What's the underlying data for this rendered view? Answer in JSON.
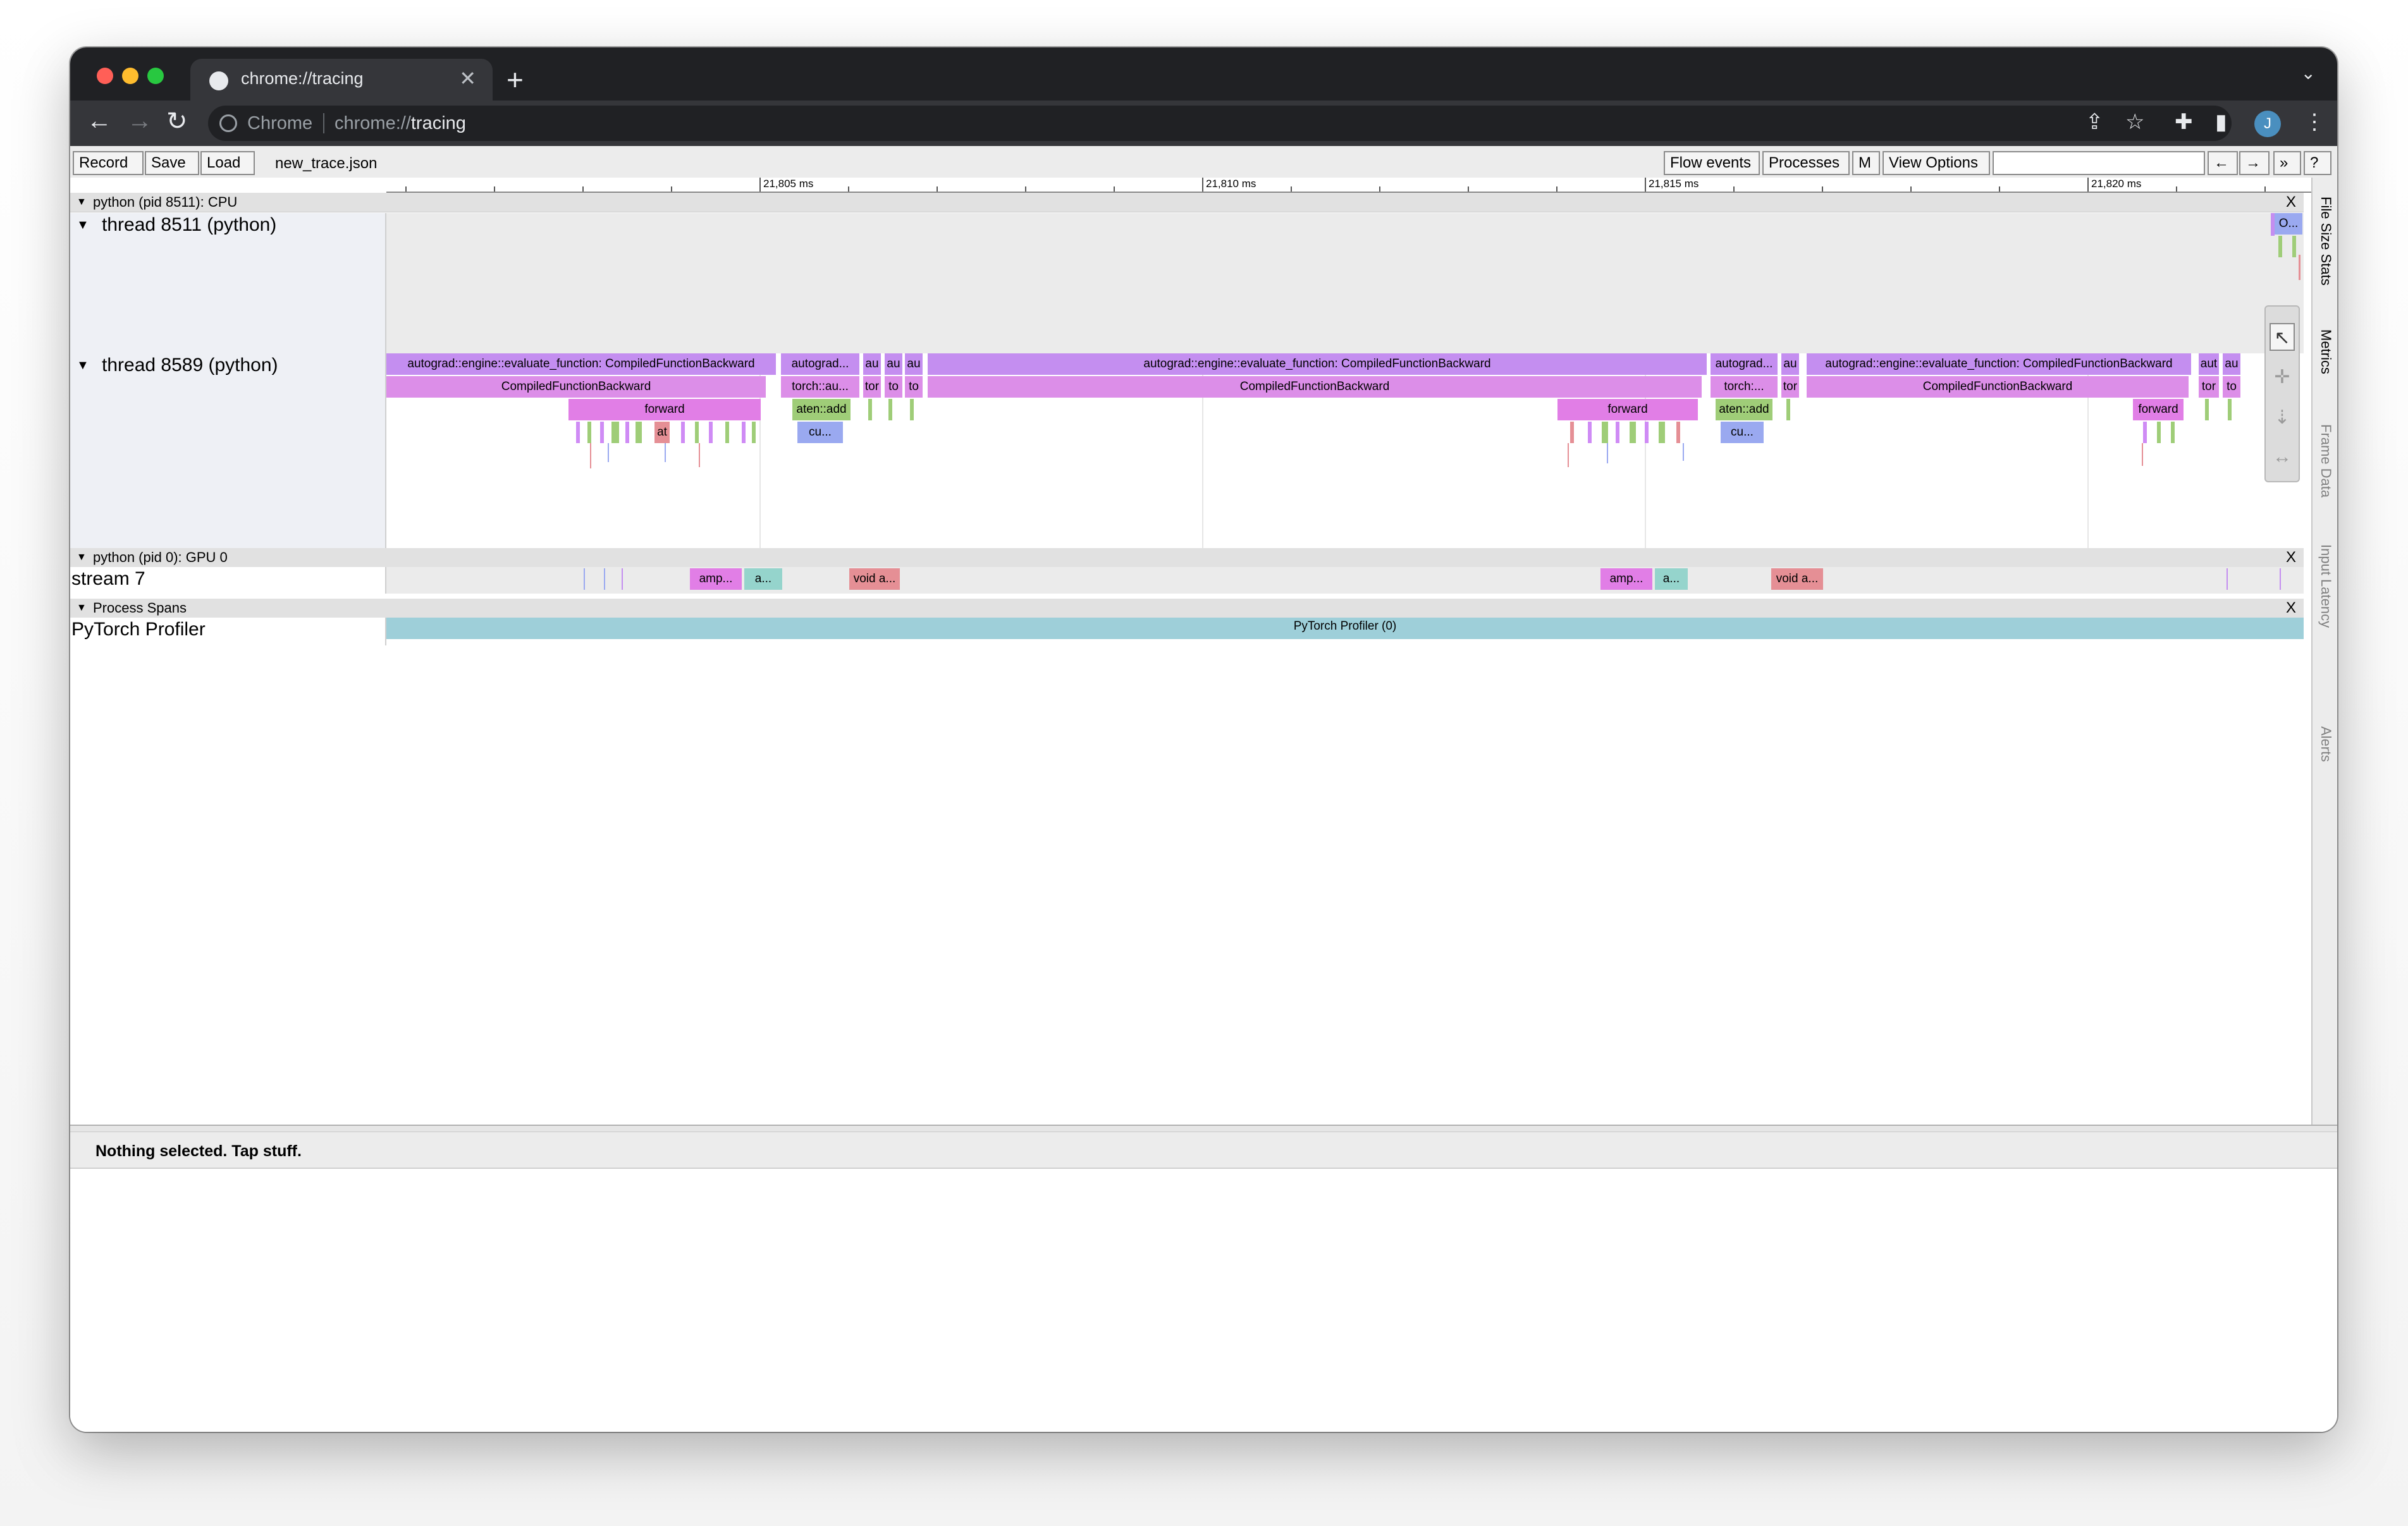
{
  "browser": {
    "tab_title": "chrome://tracing",
    "tab_close": "✕",
    "new_tab": "+",
    "tab_menu": "⌄",
    "omnibox_site": "Chrome",
    "omnibox_url_scheme": "chrome://",
    "omnibox_url_host": "tracing",
    "avatar_initial": "J",
    "nav": {
      "back": "←",
      "forward": "→",
      "reload": "↻"
    },
    "icons": {
      "share": "⇪",
      "star": "☆",
      "ext": "✚",
      "sidebar": "▮",
      "menu": "⋮"
    }
  },
  "controls": {
    "record": "Record",
    "save": "Save",
    "load": "Load",
    "filename": "new_trace.json",
    "flow_events": "Flow events",
    "processes": "Processes",
    "m": "M",
    "view_options": "View Options",
    "search_placeholder": "",
    "prev": "←",
    "next": "→",
    "more": "»",
    "help": "?"
  },
  "ruler": {
    "labels": [
      "21,805 ms",
      "21,810 ms",
      "21,815 ms",
      "21,820 ms"
    ]
  },
  "processes": {
    "cpu": {
      "title": "python (pid 8511): CPU",
      "close": "X"
    },
    "gpu": {
      "title": "python (pid 0): GPU 0",
      "close": "X"
    },
    "spans": {
      "title": "Process Spans",
      "close": "X"
    }
  },
  "threads": {
    "t8511": "thread 8511 (python)",
    "t8589": "thread 8589 (python)",
    "stream7": "stream 7",
    "profiler": "PyTorch Profiler"
  },
  "slices": {
    "eval1": "autograd::engine::evaluate_function: CompiledFunctionBackward",
    "eval2": "autograd...",
    "au1": "au",
    "au2": "au",
    "au3": "au",
    "eval3": "autograd::engine::evaluate_function: CompiledFunctionBackward",
    "eval4": "autograd...",
    "au4": "au",
    "eval5": "autograd::engine::evaluate_function: CompiledFunctionBackward",
    "aut": "aut",
    "au5": "au",
    "cfb1": "CompiledFunctionBackward",
    "torchau": "torch::au...",
    "tor1": "tor",
    "to1": "to",
    "to2": "to",
    "cfb2": "CompiledFunctionBackward",
    "torch2": "torch:...",
    "tor2": "tor",
    "cfb3": "CompiledFunctionBackward",
    "tor3": "tor",
    "to3": "to",
    "fwd1": "forward",
    "add1": "aten::add",
    "fwd2": "forward",
    "add2": "aten::add",
    "fwd3": "forward",
    "at1": "at",
    "cu1": "cu...",
    "cu2": "cu...",
    "o1": "O...",
    "amp1": "amp...",
    "a1": "a...",
    "void1": "void a...",
    "amp2": "amp...",
    "a2": "a...",
    "void2": "void a...",
    "profiler_span": "PyTorch Profiler (0)"
  },
  "side_tabs": {
    "file_size": "File Size Stats",
    "metrics": "Metrics",
    "frame_data": "Frame Data",
    "input_latency": "Input Latency",
    "alerts": "Alerts"
  },
  "mouse_mode": {
    "select": "↖",
    "pan": "✛",
    "zoom": "⇣",
    "timing": "↔"
  },
  "analysis": {
    "status": "Nothing selected. Tap stuff."
  },
  "colors": {
    "purple": "#c48ef0",
    "magenta": "#e17ee6",
    "pink": "#dc8ee8",
    "lilac": "#cf8bf5",
    "green": "#9fcd78",
    "blue": "#9aa9f0",
    "salmon": "#e58f95",
    "teal": "#95d4cc",
    "span": "#9ecfd9"
  }
}
